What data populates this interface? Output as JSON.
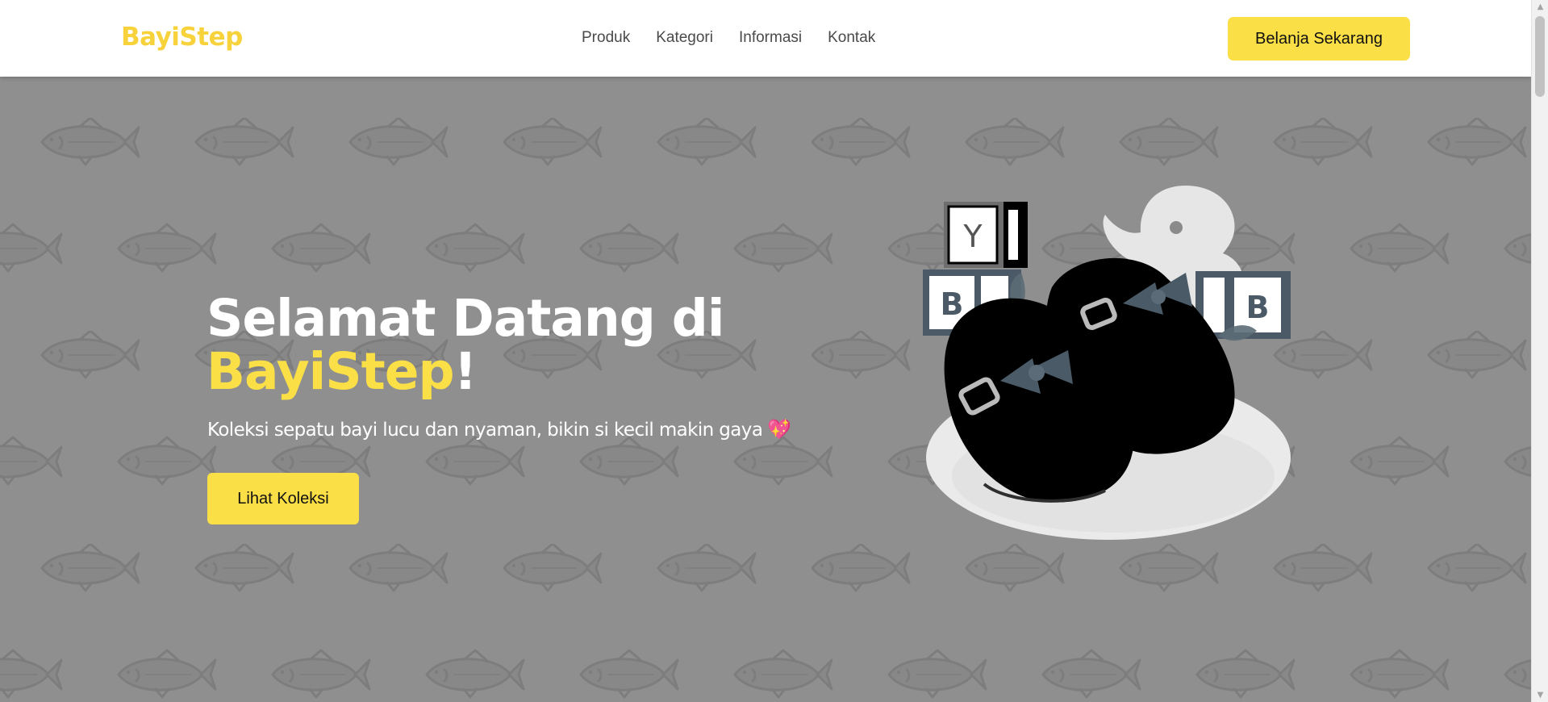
{
  "header": {
    "logo": "BayiStep",
    "nav": [
      "Produk",
      "Kategori",
      "Informasi",
      "Kontak"
    ],
    "cta_label": "Belanja Sekarang"
  },
  "hero": {
    "title_prefix": "Selamat Datang di",
    "title_brand": "BayiStep",
    "title_suffix": "!",
    "subtitle": "Koleksi sepatu bayi lucu dan nyaman, bikin si kecil makin gaya",
    "subtitle_emoji": "💖",
    "button_label": "Lihat Koleksi",
    "illustration": {
      "blocks": [
        "Y",
        "B",
        "B"
      ]
    }
  },
  "colors": {
    "accent": "#fbdf46",
    "logo": "#f7d23b",
    "hero_bg": "#8f8f8f",
    "header_bg": "#ffffff",
    "heart": "#ee3f7a"
  },
  "icons": {
    "pattern": "fish-icon",
    "subtitle_emoji": "sparkling-heart-icon",
    "scroll_up": "scroll-up-arrow-icon",
    "scroll_down": "scroll-down-arrow-icon"
  }
}
